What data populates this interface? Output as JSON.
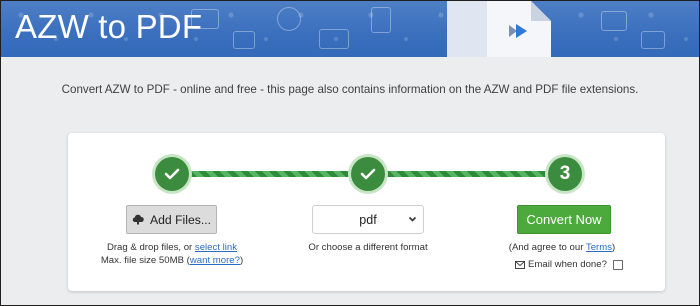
{
  "header": {
    "title": "AZW to PDF"
  },
  "intro": {
    "text": "Convert AZW to PDF - online and free - this page also contains information on the AZW and PDF file extensions."
  },
  "steps": [
    {
      "state": "done"
    },
    {
      "state": "done"
    },
    {
      "state": "current",
      "number": "3"
    }
  ],
  "upload": {
    "button_label": "Add Files...",
    "drag_text": "Drag & drop files, or ",
    "select_link": "select link",
    "max_size_text": "Max. file size 50MB (",
    "more_link": "want more?",
    "max_size_close": ")"
  },
  "format": {
    "selected": "pdf",
    "hint": "Or choose a different format"
  },
  "convert": {
    "button_label": "Convert Now",
    "agree_text": "(And agree to our ",
    "terms_link": "Terms",
    "agree_close": ")",
    "email_label": "Email when done?",
    "email_checked": false
  },
  "colors": {
    "banner": "#3a6fbd",
    "step_green": "#3b8c3e",
    "convert_green": "#4caa3c",
    "link_blue": "#2b6cc4"
  }
}
